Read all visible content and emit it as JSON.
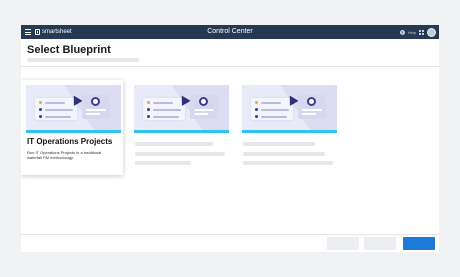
{
  "topbar": {
    "brand": "smartsheet",
    "app_title": "Control Center",
    "help_label": "Help",
    "help_glyph": "?"
  },
  "page": {
    "title": "Select Blueprint"
  },
  "cards": [
    {
      "title": "IT Operations Projects",
      "description": "Run IT Operations Projects in a traditional waterfall PM methodology.",
      "selected": true
    },
    {
      "title": "",
      "description": "",
      "selected": false,
      "loading": true
    },
    {
      "title": "",
      "description": "",
      "selected": false,
      "loading": true
    }
  ],
  "colors": {
    "topbar": "#253952",
    "accent": "#30c3ed",
    "primary_button": "#1d7bd7",
    "thumb_bg": "#e9eaf8",
    "dot_orange": "#f5a623",
    "dot_navy": "#3b3e8a"
  },
  "icons": {
    "menu": "hamburger-icon",
    "brand": "smartsheet-logo-icon",
    "help": "help-icon",
    "apps": "app-grid-icon",
    "profile": "avatar"
  }
}
